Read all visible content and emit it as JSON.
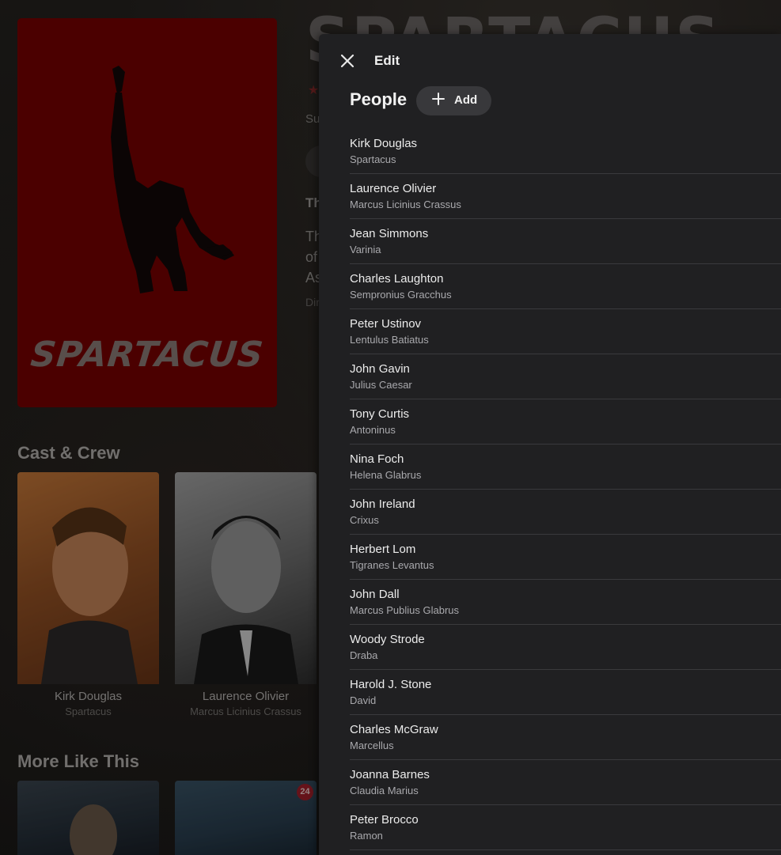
{
  "movie": {
    "title_fragment": "SPARTACUS",
    "poster_title": "SPARTACUS",
    "subtitle_fragment": "Su",
    "tagline_fragment": "Th",
    "overview_fragment_1": "Th",
    "overview_fragment_2": "of",
    "overview_fragment_3": "As",
    "director_fragment": "Dir",
    "star_icon": "star-icon"
  },
  "sections": {
    "cast_crew": "Cast & Crew",
    "more_like_this": "More Like This"
  },
  "cast_cards": [
    {
      "name": "Kirk Douglas",
      "role": "Spartacus"
    },
    {
      "name": "Laurence Olivier",
      "role": "Marcus Licinius Crassus"
    }
  ],
  "more_like_this": {
    "badge": "24"
  },
  "panel": {
    "title": "Edit",
    "close_icon": "close-icon",
    "section_title": "People",
    "add_label": "Add",
    "people": [
      {
        "name": "Kirk Douglas",
        "role": "Spartacus"
      },
      {
        "name": "Laurence Olivier",
        "role": "Marcus Licinius Crassus"
      },
      {
        "name": "Jean Simmons",
        "role": "Varinia"
      },
      {
        "name": "Charles Laughton",
        "role": "Sempronius Gracchus"
      },
      {
        "name": "Peter Ustinov",
        "role": "Lentulus Batiatus"
      },
      {
        "name": "John Gavin",
        "role": "Julius Caesar"
      },
      {
        "name": "Tony Curtis",
        "role": "Antoninus"
      },
      {
        "name": "Nina Foch",
        "role": "Helena Glabrus"
      },
      {
        "name": "John Ireland",
        "role": "Crixus"
      },
      {
        "name": "Herbert Lom",
        "role": "Tigranes Levantus"
      },
      {
        "name": "John Dall",
        "role": "Marcus Publius Glabrus"
      },
      {
        "name": "Woody Strode",
        "role": "Draba"
      },
      {
        "name": "Harold J. Stone",
        "role": "David"
      },
      {
        "name": "Charles McGraw",
        "role": "Marcellus"
      },
      {
        "name": "Joanna Barnes",
        "role": "Claudia Marius"
      },
      {
        "name": "Peter Brocco",
        "role": "Ramon"
      }
    ]
  },
  "colors": {
    "poster_red": "#7a0000",
    "panel_bg": "#202022",
    "badge_red": "#a3202a"
  }
}
